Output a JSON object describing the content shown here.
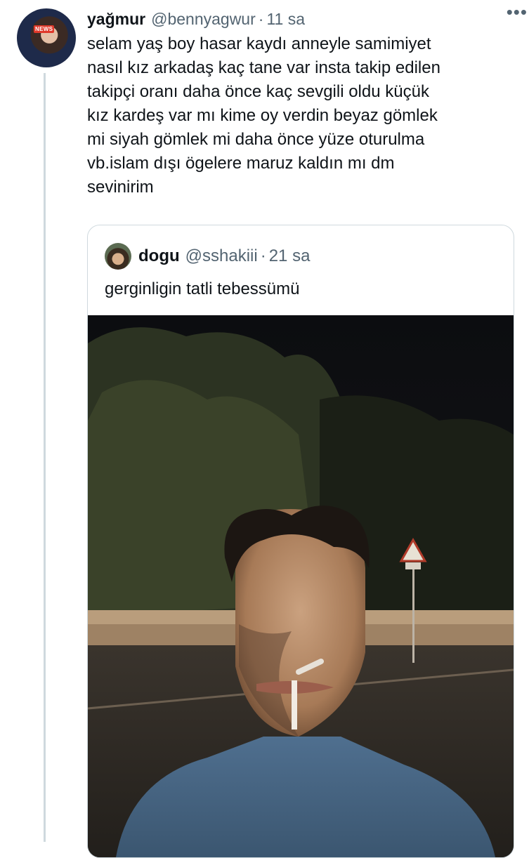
{
  "tweet": {
    "author_name": "yağmur",
    "author_handle": "@bennyagwur",
    "separator": "·",
    "time": "11 sa",
    "more_icon": "more-icon",
    "avatar_badge": "NEWS",
    "text": "selam yaş boy hasar kaydı anneyle samimiyet\nnasıl kız arkadaş kaç tane var insta takip edilen\ntakipçi oranı daha önce kaç sevgili oldu küçük\nkız kardeş var mı kime oy verdin beyaz gömlek\nmi siyah gömlek mi daha önce yüze oturulma\nvb.islam dışı ögelere maruz kaldın mı dm\nsevinirim"
  },
  "quote": {
    "author_name": "dogu",
    "author_handle": "@sshakiii",
    "separator": "·",
    "time": "21 sa",
    "text": "gerginligin tatli tebessümü"
  },
  "colors": {
    "text_primary": "#0f1419",
    "text_secondary": "#536471",
    "border": "#cfd9de"
  }
}
